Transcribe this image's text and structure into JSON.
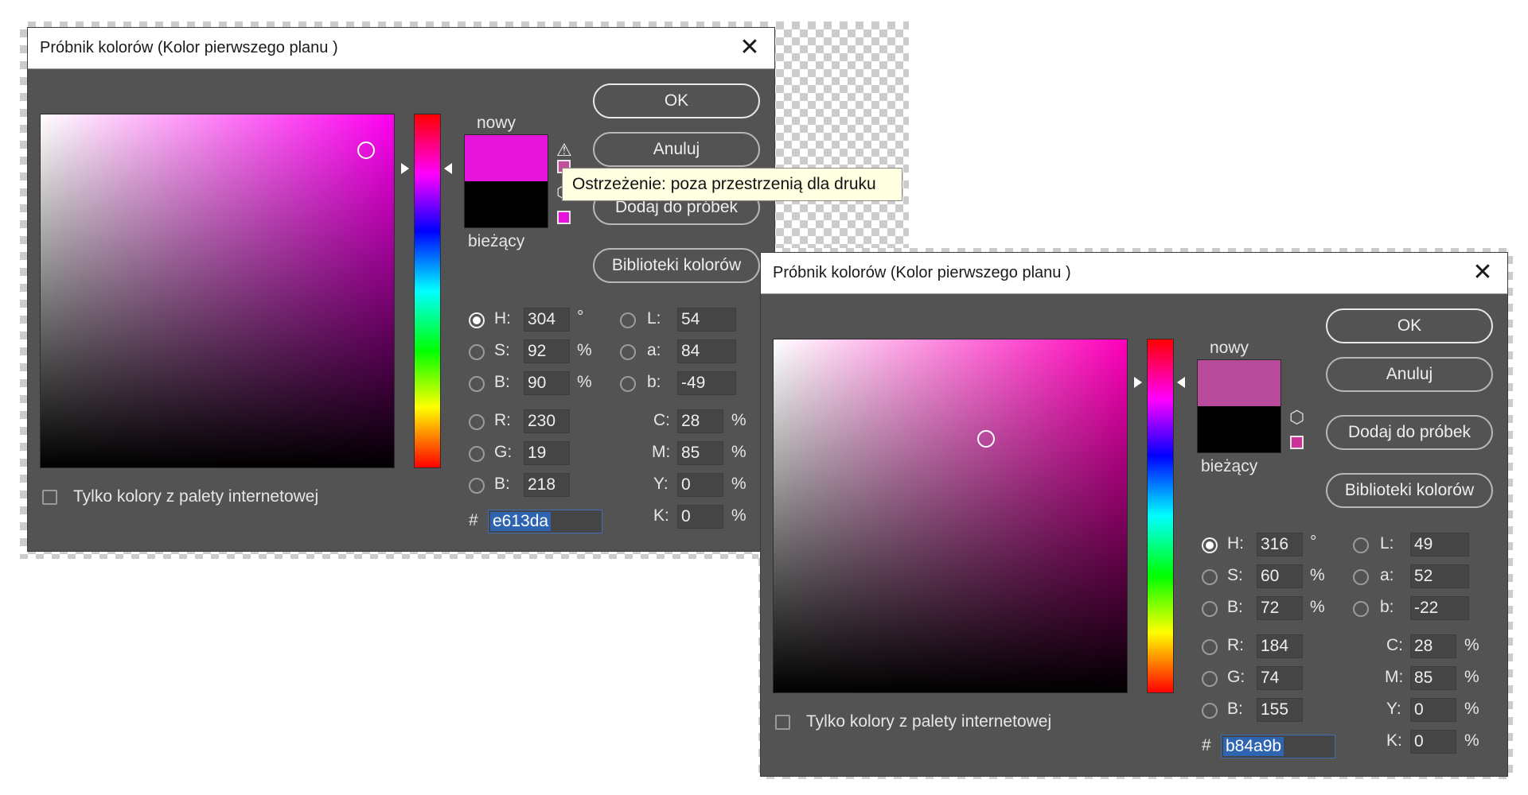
{
  "dialogs": [
    {
      "title": "Próbnik kolorów (Kolor pierwszego planu )",
      "new_color": "#e613da",
      "current_color": "#000000",
      "hue_color": "#ff00f1",
      "saturation_pct": 92,
      "brightness_pct": 90,
      "hue_deg": 304,
      "label_new": "nowy",
      "label_current": "bieżący",
      "buttons": {
        "ok": "OK",
        "cancel": "Anuluj",
        "add_swatch": "Dodaj do próbek",
        "libraries": "Biblioteki kolorów"
      },
      "fields": {
        "H": "304",
        "S": "92",
        "B": "90",
        "L": "54",
        "a": "84",
        "b": "-49",
        "R": "230",
        "G": "19",
        "B2": "218",
        "C": "28",
        "M": "85",
        "Y": "0",
        "K": "0"
      },
      "labels": {
        "H": "H:",
        "S": "S:",
        "B": "B:",
        "L": "L:",
        "a": "a:",
        "b": "b:",
        "R": "R:",
        "G": "G:",
        "B2": "B:",
        "C": "C:",
        "M": "M:",
        "Y": "Y:",
        "K": "K:"
      },
      "units": {
        "deg": "°",
        "pct": "%"
      },
      "selected_mode": "H",
      "hex_prefix": "#",
      "hex": "e613da",
      "web_only_label": "Tylko kolory z palety internetowej",
      "gamut_warning_shown": true,
      "gamut_swatch": "#c0509a",
      "web_swatch": "#e613da",
      "tooltip": "Ostrzeżenie: poza przestrzenią dla druku"
    },
    {
      "title": "Próbnik kolorów (Kolor pierwszego planu )",
      "new_color": "#b84a9b",
      "current_color": "#000000",
      "hue_color": "#ff00bb",
      "saturation_pct": 60,
      "brightness_pct": 72,
      "hue_deg": 316,
      "label_new": "nowy",
      "label_current": "bieżący",
      "buttons": {
        "ok": "OK",
        "cancel": "Anuluj",
        "add_swatch": "Dodaj do próbek",
        "libraries": "Biblioteki kolorów"
      },
      "fields": {
        "H": "316",
        "S": "60",
        "B": "72",
        "L": "49",
        "a": "52",
        "b": "-22",
        "R": "184",
        "G": "74",
        "B2": "155",
        "C": "28",
        "M": "85",
        "Y": "0",
        "K": "0"
      },
      "labels": {
        "H": "H:",
        "S": "S:",
        "B": "B:",
        "L": "L:",
        "a": "a:",
        "b": "b:",
        "R": "R:",
        "G": "G:",
        "B2": "B:",
        "C": "C:",
        "M": "M:",
        "Y": "Y:",
        "K": "K:"
      },
      "units": {
        "deg": "°",
        "pct": "%"
      },
      "selected_mode": "H",
      "hex_prefix": "#",
      "hex": "b84a9b",
      "web_only_label": "Tylko kolory z palety internetowej",
      "gamut_warning_shown": false,
      "web_swatch": "#cc3399"
    }
  ]
}
